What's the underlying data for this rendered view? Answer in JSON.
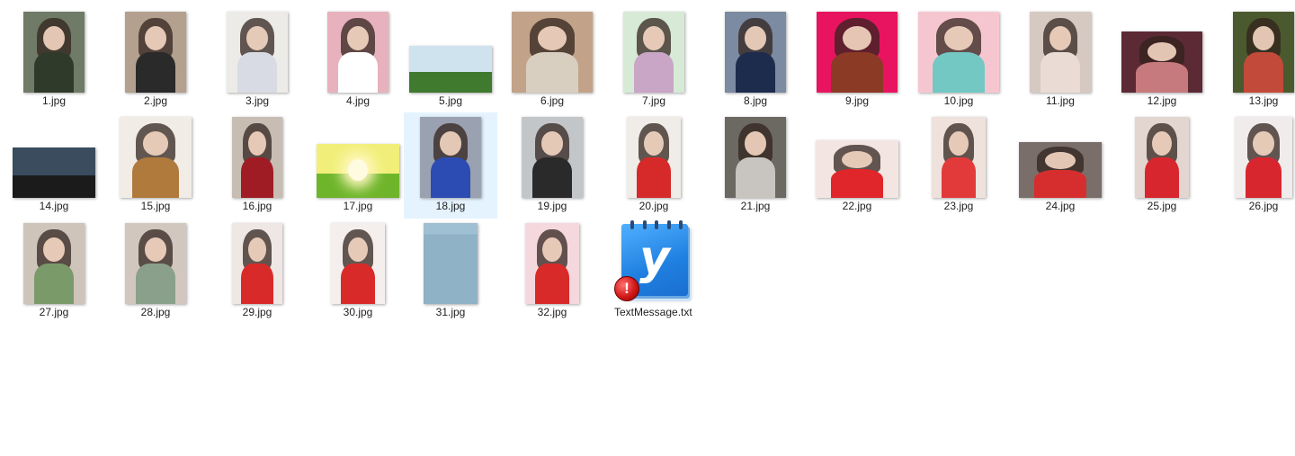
{
  "files": [
    {
      "name": "1.jpg",
      "selected": false,
      "thumb": {
        "w": 68,
        "h": 90,
        "kind": "portrait",
        "bg": "#6f7b66",
        "body": "#2f3a2a"
      }
    },
    {
      "name": "2.jpg",
      "selected": false,
      "thumb": {
        "w": 68,
        "h": 90,
        "kind": "portrait",
        "bg": "#b3a08e",
        "body": "#2a2a2a"
      }
    },
    {
      "name": "3.jpg",
      "selected": false,
      "thumb": {
        "w": 68,
        "h": 90,
        "kind": "portrait",
        "bg": "#ecebe8",
        "body": "#d8dbe3"
      }
    },
    {
      "name": "4.jpg",
      "selected": false,
      "thumb": {
        "w": 68,
        "h": 90,
        "kind": "portrait",
        "bg": "#e7b2bd",
        "body": "#ffffff"
      }
    },
    {
      "name": "5.jpg",
      "selected": false,
      "thumb": {
        "w": 92,
        "h": 52,
        "kind": "landscape",
        "bg": "#cfe3ee",
        "body": "#3f7a2e"
      }
    },
    {
      "name": "6.jpg",
      "selected": false,
      "thumb": {
        "w": 90,
        "h": 90,
        "kind": "portrait",
        "bg": "#c2a389",
        "body": "#d9cfc1"
      }
    },
    {
      "name": "7.jpg",
      "selected": false,
      "thumb": {
        "w": 68,
        "h": 90,
        "kind": "portrait",
        "bg": "#d6ead6",
        "body": "#c9a5c6"
      }
    },
    {
      "name": "8.jpg",
      "selected": false,
      "thumb": {
        "w": 68,
        "h": 90,
        "kind": "portrait",
        "bg": "#7c8aa2",
        "body": "#1d2b4d"
      }
    },
    {
      "name": "9.jpg",
      "selected": false,
      "thumb": {
        "w": 90,
        "h": 90,
        "kind": "portrait",
        "bg": "#e8145f",
        "body": "#8a3a25"
      }
    },
    {
      "name": "10.jpg",
      "selected": false,
      "thumb": {
        "w": 90,
        "h": 90,
        "kind": "portrait",
        "bg": "#f6c6d0",
        "body": "#73c8c4"
      }
    },
    {
      "name": "11.jpg",
      "selected": false,
      "thumb": {
        "w": 68,
        "h": 90,
        "kind": "portrait",
        "bg": "#d5c9c2",
        "body": "#eadbd4"
      }
    },
    {
      "name": "12.jpg",
      "selected": false,
      "thumb": {
        "w": 90,
        "h": 68,
        "kind": "portrait",
        "bg": "#5b2a34",
        "body": "#c77a7d"
      }
    },
    {
      "name": "13.jpg",
      "selected": false,
      "thumb": {
        "w": 68,
        "h": 90,
        "kind": "portrait",
        "bg": "#4a5a2e",
        "body": "#c24a3a"
      }
    },
    {
      "name": "14.jpg",
      "selected": false,
      "thumb": {
        "w": 92,
        "h": 56,
        "kind": "landscape",
        "bg": "#3a4c5e",
        "body": "#1b1b1b"
      }
    },
    {
      "name": "15.jpg",
      "selected": false,
      "thumb": {
        "w": 80,
        "h": 90,
        "kind": "portrait",
        "bg": "#f1ede6",
        "body": "#b07a3c"
      }
    },
    {
      "name": "16.jpg",
      "selected": false,
      "thumb": {
        "w": 56,
        "h": 90,
        "kind": "portrait",
        "bg": "#c8bdb3",
        "body": "#a01c25"
      }
    },
    {
      "name": "17.jpg",
      "selected": false,
      "thumb": {
        "w": 92,
        "h": 60,
        "kind": "landscape",
        "bg": "#f1ef7a",
        "body": "#6fb52b"
      }
    },
    {
      "name": "18.jpg",
      "selected": true,
      "thumb": {
        "w": 68,
        "h": 90,
        "kind": "portrait",
        "bg": "#9aa1b0",
        "body": "#2c4bb3"
      }
    },
    {
      "name": "19.jpg",
      "selected": false,
      "thumb": {
        "w": 68,
        "h": 90,
        "kind": "portrait",
        "bg": "#c3c6c9",
        "body": "#2a2a2a"
      }
    },
    {
      "name": "20.jpg",
      "selected": false,
      "thumb": {
        "w": 60,
        "h": 90,
        "kind": "portrait",
        "bg": "#f0ece8",
        "body": "#d62a2a"
      }
    },
    {
      "name": "21.jpg",
      "selected": false,
      "thumb": {
        "w": 68,
        "h": 90,
        "kind": "portrait",
        "bg": "#6c6862",
        "body": "#c8c4bf"
      }
    },
    {
      "name": "22.jpg",
      "selected": false,
      "thumb": {
        "w": 92,
        "h": 64,
        "kind": "portrait",
        "bg": "#f3e6e2",
        "body": "#e0262a"
      }
    },
    {
      "name": "23.jpg",
      "selected": false,
      "thumb": {
        "w": 60,
        "h": 90,
        "kind": "portrait",
        "bg": "#efe1dc",
        "body": "#e23a3a"
      }
    },
    {
      "name": "24.jpg",
      "selected": false,
      "thumb": {
        "w": 92,
        "h": 62,
        "kind": "portrait",
        "bg": "#7a6e6a",
        "body": "#d62e2e"
      }
    },
    {
      "name": "25.jpg",
      "selected": false,
      "thumb": {
        "w": 60,
        "h": 90,
        "kind": "portrait",
        "bg": "#e3d6d0",
        "body": "#d8262e"
      }
    },
    {
      "name": "26.jpg",
      "selected": false,
      "thumb": {
        "w": 64,
        "h": 90,
        "kind": "portrait",
        "bg": "#f0eceb",
        "body": "#d8262e"
      }
    },
    {
      "name": "27.jpg",
      "selected": false,
      "thumb": {
        "w": 68,
        "h": 90,
        "kind": "portrait",
        "bg": "#cfc4ba",
        "body": "#7a9a6a"
      }
    },
    {
      "name": "28.jpg",
      "selected": false,
      "thumb": {
        "w": 68,
        "h": 90,
        "kind": "portrait",
        "bg": "#d2c7bf",
        "body": "#8aa08a"
      }
    },
    {
      "name": "29.jpg",
      "selected": false,
      "thumb": {
        "w": 56,
        "h": 90,
        "kind": "portrait",
        "bg": "#efe7e4",
        "body": "#d92a2a"
      }
    },
    {
      "name": "30.jpg",
      "selected": false,
      "thumb": {
        "w": 60,
        "h": 90,
        "kind": "portrait",
        "bg": "#f4efec",
        "body": "#d92a2a"
      }
    },
    {
      "name": "31.jpg",
      "selected": false,
      "thumb": {
        "w": 60,
        "h": 90,
        "kind": "blank",
        "bg": "#8fb2c6",
        "body": "#8fb2c6"
      }
    },
    {
      "name": "32.jpg",
      "selected": false,
      "thumb": {
        "w": 60,
        "h": 90,
        "kind": "portrait",
        "bg": "#f4d8de",
        "body": "#d92a2a"
      }
    }
  ],
  "text_file": {
    "name": "TextMessage.txt",
    "glyph": "y",
    "badge": "!",
    "icon": "notepad-file-icon",
    "badge_icon": "error-badge-icon",
    "colors": {
      "page": "#1f7fe0",
      "badge": "#d21818"
    }
  },
  "colors": {
    "selection": "#e5f3ff",
    "label": "#1e1e1e",
    "background": "#ffffff"
  }
}
